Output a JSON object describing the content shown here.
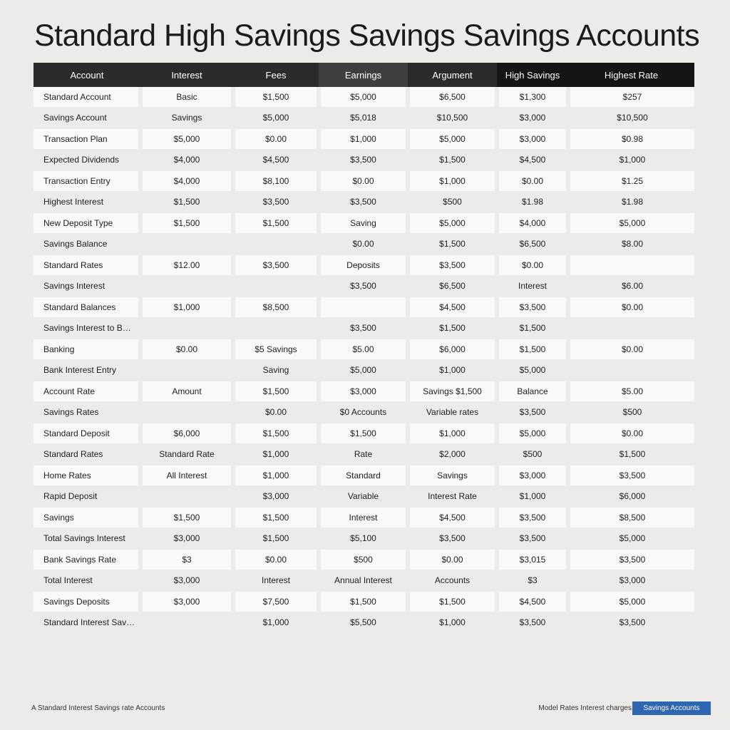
{
  "title": "Standard High Savings Savings Savings Accounts",
  "table": {
    "headers": [
      "Account",
      "Interest",
      "Fees",
      "Earnings",
      "Argument",
      "High Savings",
      "Highest Rate"
    ],
    "rows": [
      [
        "Standard Account",
        "Basic",
        "$1,500",
        "$5,000",
        "$6,500",
        "$1,300",
        "$257"
      ],
      [
        "Savings Account",
        "Savings",
        "$5,000",
        "$5,018",
        "$10,500",
        "$3,000",
        "$10,500"
      ],
      [
        "Transaction Plan",
        "$5,000",
        "$0.00",
        "$1,000",
        "$5,000",
        "$3,000",
        "$0.98"
      ],
      [
        "Expected Dividends",
        "$4,000",
        "$4,500",
        "$3,500",
        "$1,500",
        "$4,500",
        "$1,000"
      ],
      [
        "Transaction Entry",
        "$4,000",
        "$8,100",
        "$0.00",
        "$1,000",
        "$0.00",
        "$1.25"
      ],
      [
        "Highest Interest",
        "$1,500",
        "$3,500",
        "$3,500",
        "$500",
        "$1.98",
        "$1.98"
      ],
      [
        "New Deposit Type",
        "$1,500",
        "$1,500",
        "Saving",
        "$5,000",
        "$4,000",
        "$5,000"
      ],
      [
        "Savings Balance",
        "",
        "",
        "$0.00",
        "$1,500",
        "$6,500",
        "$8.00"
      ],
      [
        "Standard Rates",
        "$12.00",
        "$3,500",
        "Deposits",
        "$3,500",
        "$0.00",
        ""
      ],
      [
        "Savings Interest",
        "",
        "",
        "$3,500",
        "$6,500",
        "Interest",
        "$6.00"
      ],
      [
        "Standard Balances",
        "$1,000",
        "$8,500",
        "",
        "$4,500",
        "$3,500",
        "$0.00"
      ],
      [
        "Savings Interest to Banking",
        "",
        "",
        "$3,500",
        "$1,500",
        "$1,500",
        ""
      ],
      [
        "Banking",
        "$0.00",
        "$5 Savings",
        "$5.00",
        "$6,000",
        "$1,500",
        "$0.00"
      ],
      [
        "Bank Interest Entry",
        "",
        "Saving",
        "$5,000",
        "$1,000",
        "$5,000",
        ""
      ],
      [
        "Account Rate",
        "Amount",
        "$1,500",
        "$3,000",
        "Savings $1,500",
        "Balance",
        "$5.00"
      ],
      [
        "Savings Rates",
        "",
        "$0.00",
        "$0 Accounts",
        "Variable rates",
        "$3,500",
        "$500"
      ],
      [
        "Standard Deposit",
        "$6,000",
        "$1,500",
        "$1,500",
        "$1,000",
        "$5,000",
        "$0.00"
      ],
      [
        "Standard Rates",
        "Standard Rate",
        "$1,000",
        "Rate",
        "$2,000",
        "$500",
        "$1,500"
      ],
      [
        "Home Rates",
        "All Interest",
        "$1,000",
        "Standard",
        "Savings",
        "$3,000",
        "$3,500"
      ],
      [
        "Rapid Deposit",
        "",
        "$3,000",
        "Variable",
        "Interest Rate",
        "$1,000",
        "$6,000"
      ],
      [
        "Savings",
        "$1,500",
        "$1,500",
        "Interest",
        "$4,500",
        "$3,500",
        "$8,500"
      ],
      [
        "Total Savings Interest",
        "$3,000",
        "$1,500",
        "$5,100",
        "$3,500",
        "$3,500",
        "$5,000"
      ],
      [
        "Bank Savings Rate",
        "$3",
        "$0.00",
        "$500",
        "$0.00",
        "$3,015",
        "$3,500"
      ],
      [
        "Total Interest",
        "$3,000",
        "Interest",
        "Annual Interest",
        "Accounts",
        "$3",
        "$3,000"
      ],
      [
        "Savings Deposits",
        "$3,000",
        "$7,500",
        "$1,500",
        "$1,500",
        "$4,500",
        "$5,000"
      ],
      [
        "Standard Interest Savings",
        "",
        "$1,000",
        "$5,500",
        "$1,000",
        "$3,500",
        "$3,500"
      ]
    ]
  },
  "footer": {
    "note": "A Standard Interest Savings rate Accounts",
    "right_text": "Model Rates Interest charges",
    "button_label": "Savings Accounts"
  }
}
